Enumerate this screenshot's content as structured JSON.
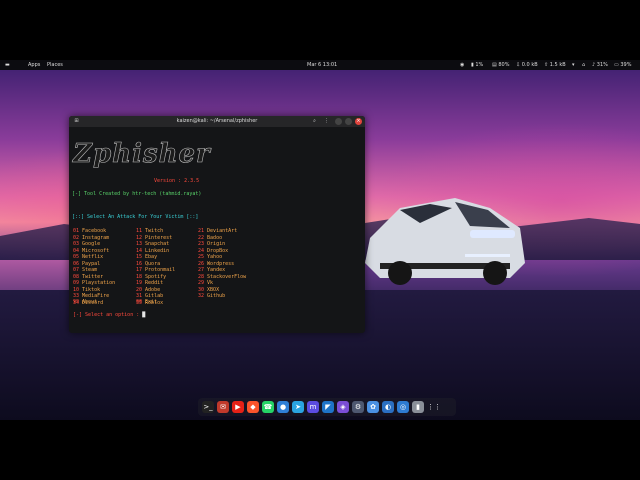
{
  "topbar": {
    "menu_icon": "menu-bars-icon",
    "apps": "Apps",
    "places": "Places",
    "clock": "Mar 6 13:01",
    "cpu": "1%",
    "mem": "80%",
    "net_down": "0.0 kB",
    "net_up": "1.5 kB",
    "volume": "31%",
    "battery": "39%"
  },
  "terminal": {
    "title": "kaizen@kali: ~/Arsenal/zphisher",
    "logo": "Zphisher",
    "version": "Version : 2.3.5",
    "credit": "[-] Tool Created by htr-tech (tahmid.rayat)",
    "select_prompt": "[::] Select An Attack For Your Victim [::]",
    "col1": [
      {
        "num": "01",
        "name": "Facebook"
      },
      {
        "num": "02",
        "name": "Instagram"
      },
      {
        "num": "03",
        "name": "Google"
      },
      {
        "num": "04",
        "name": "Microsoft"
      },
      {
        "num": "05",
        "name": "Netflix"
      },
      {
        "num": "06",
        "name": "Paypal"
      },
      {
        "num": "07",
        "name": "Steam"
      },
      {
        "num": "08",
        "name": "Twitter"
      },
      {
        "num": "09",
        "name": "Playstation"
      },
      {
        "num": "10",
        "name": "Tiktok"
      },
      {
        "num": "33",
        "name": "MediaFire"
      },
      {
        "num": "34",
        "name": "Discord"
      }
    ],
    "col2": [
      {
        "num": "11",
        "name": "Twitch"
      },
      {
        "num": "12",
        "name": "Pinterest"
      },
      {
        "num": "13",
        "name": "Snapchat"
      },
      {
        "num": "14",
        "name": "Linkedin"
      },
      {
        "num": "15",
        "name": "Ebay"
      },
      {
        "num": "16",
        "name": "Quora"
      },
      {
        "num": "17",
        "name": "Protonmail"
      },
      {
        "num": "18",
        "name": "Spotify"
      },
      {
        "num": "19",
        "name": "Reddit"
      },
      {
        "num": "20",
        "name": "Adobe"
      },
      {
        "num": "31",
        "name": "Gitlab"
      },
      {
        "num": "35",
        "name": "Roblox"
      }
    ],
    "col3": [
      {
        "num": "21",
        "name": "DeviantArt"
      },
      {
        "num": "22",
        "name": "Badoo"
      },
      {
        "num": "23",
        "name": "Origin"
      },
      {
        "num": "24",
        "name": "DropBox"
      },
      {
        "num": "25",
        "name": "Yahoo"
      },
      {
        "num": "26",
        "name": "Wordpress"
      },
      {
        "num": "27",
        "name": "Yandex"
      },
      {
        "num": "28",
        "name": "StackoverFlow"
      },
      {
        "num": "29",
        "name": "Vk"
      },
      {
        "num": "30",
        "name": "XBOX"
      },
      {
        "num": "32",
        "name": "Github"
      }
    ],
    "about": {
      "num": "99",
      "name": "About"
    },
    "exit": {
      "num": "00",
      "name": "Exit"
    },
    "option_prompt": "[-] Select an option : "
  },
  "dock": [
    "terminal-icon",
    "mail-icon",
    "youtube-icon",
    "brave-icon",
    "whatsapp-icon",
    "chat-icon",
    "telegram-icon",
    "mastodon-icon",
    "vscode-icon",
    "obsidian-icon",
    "settings-icon",
    "network-icon",
    "wireshark-icon",
    "browser-icon",
    "trash-icon",
    "apps-grid-icon"
  ],
  "colors": {
    "accent_red": "#ff4a3d",
    "accent_blue": "#49a8ff",
    "accent_cyan": "#3ad0d6",
    "accent_green": "#59d36a"
  }
}
